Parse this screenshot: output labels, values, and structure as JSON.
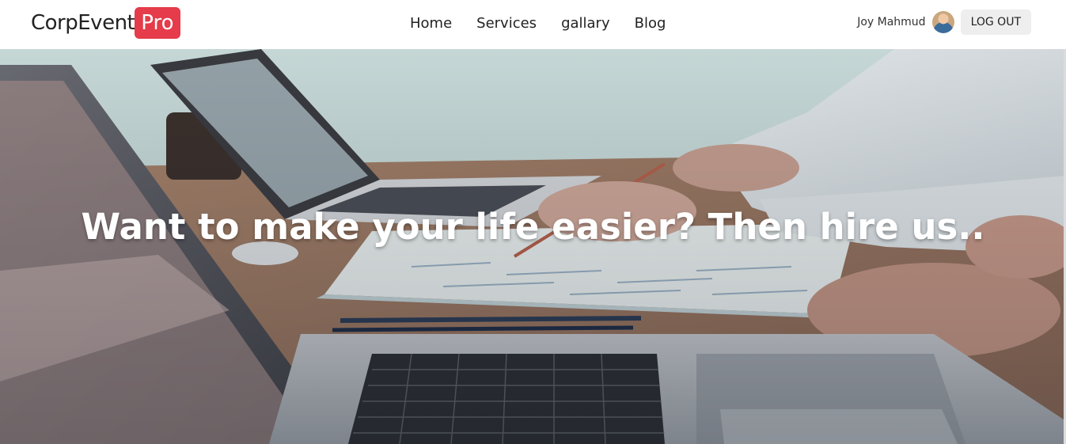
{
  "brand": {
    "name": "CorpEvent",
    "badge": "Pro"
  },
  "nav": {
    "items": [
      {
        "label": "Home"
      },
      {
        "label": "Services"
      },
      {
        "label": "gallary"
      },
      {
        "label": "Blog"
      }
    ]
  },
  "user": {
    "name": "Joy Mahmud",
    "avatar_icon": "user-avatar",
    "logout_label": "LOG OUT"
  },
  "hero": {
    "title": "Want to make your life easier? Then hire us.."
  },
  "colors": {
    "brand_badge": "#e53b4a",
    "navbar_bg": "#ffffff",
    "hero_text": "#ffffff"
  }
}
